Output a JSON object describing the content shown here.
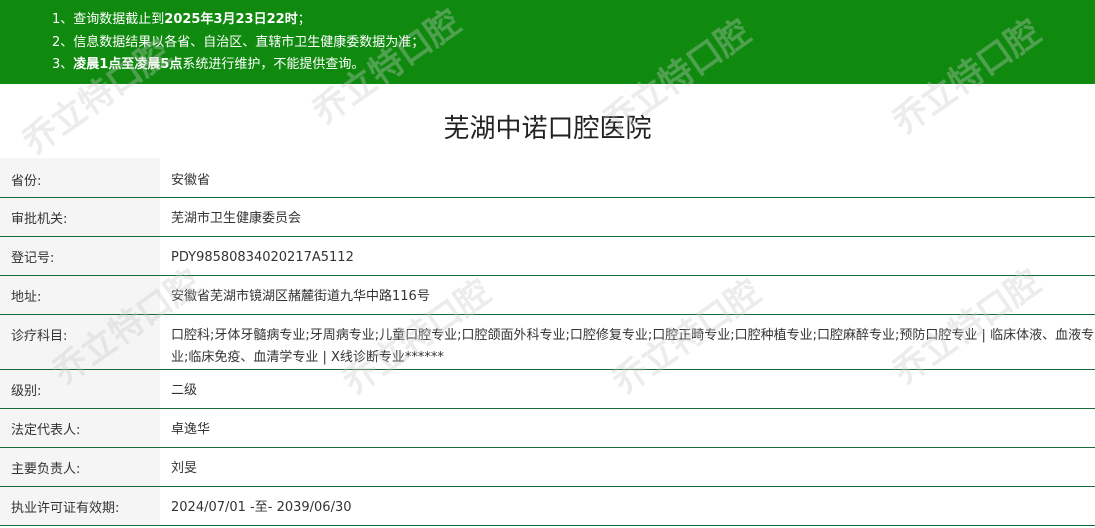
{
  "notice": {
    "line1_pre": "1、查询数据截止到",
    "line1_bold": "2025年3月23日22时",
    "line1_post": "；",
    "line2": "2、信息数据结果以各省、自治区、直辖市卫生健康委数据为准；",
    "line3_pre": "3、",
    "line3_bold": "凌晨1点至凌晨5点",
    "line3_post": "系统进行维护，不能提供查询。"
  },
  "title": "芜湖中诺口腔医院",
  "rows": [
    {
      "label": "省份:",
      "value": "安徽省"
    },
    {
      "label": "审批机关:",
      "value": "芜湖市卫生健康委员会"
    },
    {
      "label": "登记号:",
      "value": "PDY98580834020217A5112"
    },
    {
      "label": "地址:",
      "value": "安徽省芜湖市镜湖区赭麓街道九华中路116号"
    },
    {
      "label": "诊疗科目:",
      "value": "口腔科;牙体牙髓病专业;牙周病专业;儿童口腔专业;口腔颌面外科专业;口腔修复专业;口腔正畸专业;口腔种植专业;口腔麻醉专业;预防口腔专业 | 临床体液、血液专业;临床免疫、血清学专业 | X线诊断专业******"
    },
    {
      "label": "级别:",
      "value": "二级"
    },
    {
      "label": "法定代表人:",
      "value": "卓逸华"
    },
    {
      "label": "主要负责人:",
      "value": "刘旻"
    },
    {
      "label": "执业许可证有效期:",
      "value": "2024/07/01 -至- 2039/06/30"
    }
  ],
  "watermark": {
    "text": "乔立特口腔"
  }
}
